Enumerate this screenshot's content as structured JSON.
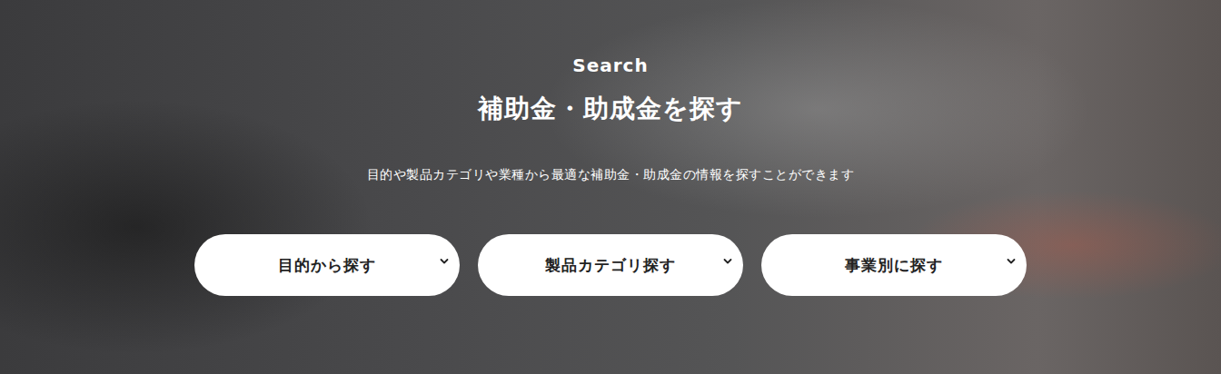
{
  "section": {
    "eyebrow": "Search",
    "title": "補助金・助成金を探す",
    "description": "目的や製品カテゴリや業種から最適な補助金・助成金の情報を探すことができます"
  },
  "dropdowns": [
    {
      "label": "目的から探す",
      "expanded": false
    },
    {
      "label": "製品カテゴリ探す",
      "expanded": false
    },
    {
      "label": "事業別に探す",
      "expanded": false
    }
  ]
}
